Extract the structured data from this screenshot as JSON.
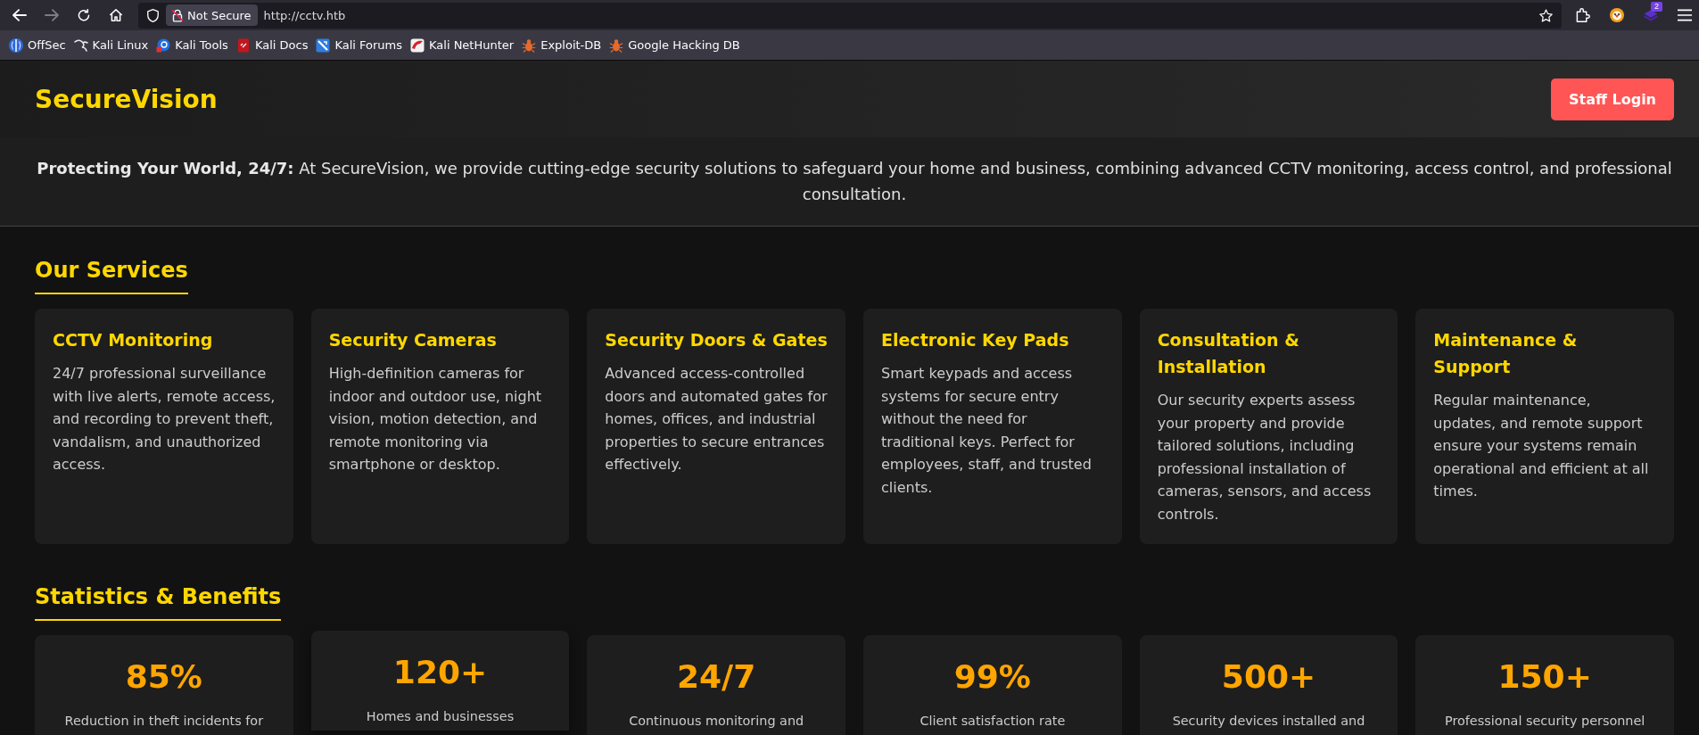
{
  "browser": {
    "nav_buttons": [
      {
        "kind": "back",
        "disabled": false
      },
      {
        "kind": "forward",
        "disabled": true
      },
      {
        "kind": "reload",
        "disabled": false
      },
      {
        "kind": "home",
        "disabled": false
      }
    ],
    "address_bar": {
      "security_label": "Not Secure",
      "url": "http://cctv.htb"
    },
    "toolbar_icons": [
      {
        "kind": "extensions"
      },
      {
        "kind": "emblem"
      },
      {
        "kind": "layers",
        "badge": "2"
      },
      {
        "kind": "menu"
      }
    ],
    "bookmarks": [
      {
        "label": "OffSec",
        "kind": "disc"
      },
      {
        "label": "Kali Linux",
        "kind": "squiggle"
      },
      {
        "label": "Kali Tools",
        "kind": "ring"
      },
      {
        "label": "Kali Docs",
        "kind": "document"
      },
      {
        "label": "Kali Forums",
        "kind": "tile"
      },
      {
        "label": "Kali NetHunter",
        "kind": "swoosh"
      },
      {
        "label": "Exploit-DB",
        "kind": "bug"
      },
      {
        "label": "Google Hacking DB",
        "kind": "bug"
      }
    ]
  },
  "header": {
    "logo": "SecureVision",
    "login_button": "Staff Login"
  },
  "intro": {
    "text": "**Protecting Your World, 24/7:** At SecureVision, we provide cutting-edge security solutions to safeguard your home and business, combining advanced CCTV monitoring, access control, and professional consultation."
  },
  "services": {
    "heading": "Our Services",
    "cards": [
      {
        "title": "CCTV Monitoring",
        "description": "24/7 professional surveillance with live alerts, remote access, and recording to prevent theft, vandalism, and unauthorized access."
      },
      {
        "title": "Security Cameras",
        "description": "High-definition cameras for indoor and outdoor use, night vision, motion detection, and remote monitoring via smartphone or desktop."
      },
      {
        "title": "Security Doors & Gates",
        "description": "Advanced access-controlled doors and automated gates for homes, offices, and industrial properties to secure entrances effectively."
      },
      {
        "title": "Electronic Key Pads",
        "description": "Smart keypads and access systems for secure entry without the need for traditional keys. Perfect for employees, staff, and trusted clients."
      },
      {
        "title": "Consultation & Installation",
        "description": "Our security experts assess your property and provide tailored solutions, including professional installation of cameras, sensors, and access controls."
      },
      {
        "title": "Maintenance & Support",
        "description": "Regular maintenance, updates, and remote support ensure your systems remain operational and efficient at all times."
      }
    ]
  },
  "statistics": {
    "heading": "Statistics & Benefits",
    "cards": [
      {
        "value": "85%",
        "label": "Reduction in theft incidents for",
        "hovered": false
      },
      {
        "value": "120+",
        "label": "Homes and businesses",
        "hovered": true
      },
      {
        "value": "24/7",
        "label": "Continuous monitoring and",
        "hovered": false
      },
      {
        "value": "99%",
        "label": "Client satisfaction rate",
        "hovered": false
      },
      {
        "value": "500+",
        "label": "Security devices installed and",
        "hovered": false
      },
      {
        "value": "150+",
        "label": "Professional security personnel",
        "hovered": false
      }
    ]
  }
}
